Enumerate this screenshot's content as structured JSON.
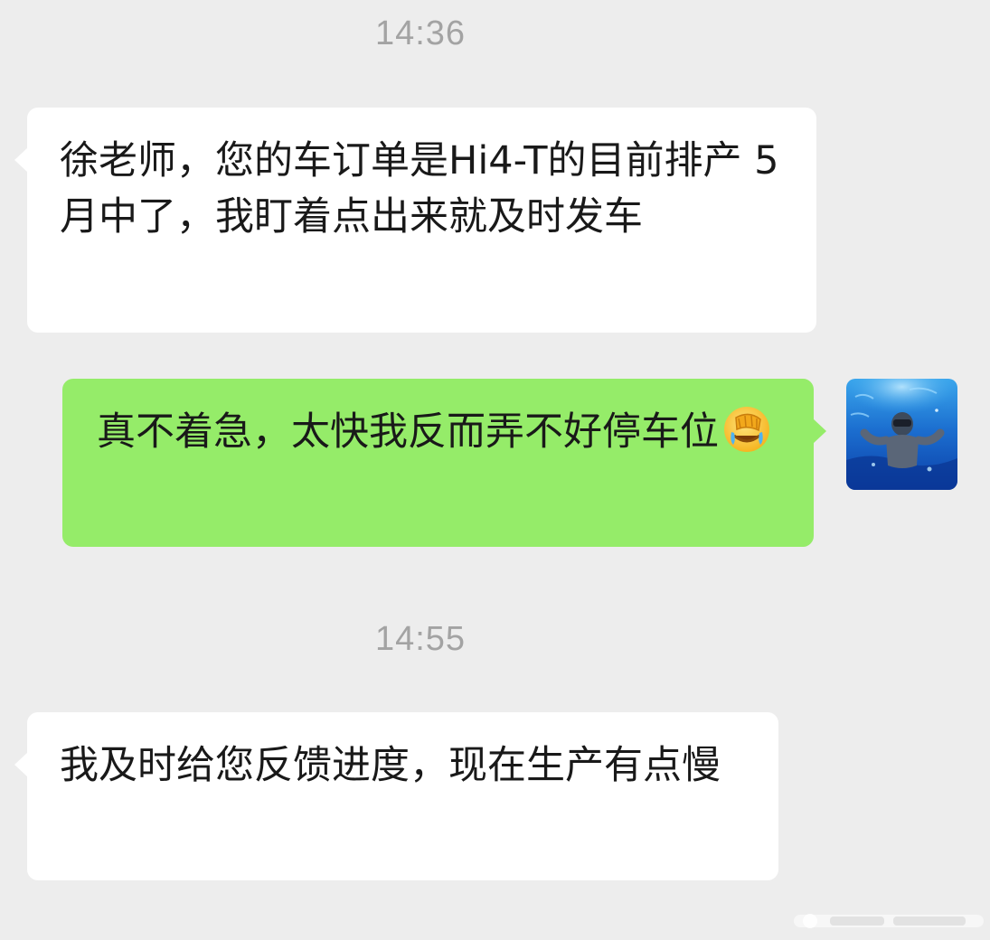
{
  "chat": {
    "timestamps": [
      "14:36",
      "14:55"
    ],
    "messages": [
      {
        "side": "left",
        "text": "徐老师，您的车订单是Hi4-T的目前排产 5月中了，我盯着点出来就及时发车"
      },
      {
        "side": "right",
        "text": "真不着急，太快我反而弄不好停车位",
        "emoji": "facepalm-crying-emoji"
      },
      {
        "side": "left",
        "text": "我及时给您反馈进度，现在生产有点慢"
      }
    ]
  },
  "colors": {
    "background": "#ededed",
    "incoming_bubble": "#ffffff",
    "outgoing_bubble": "#95ec69",
    "timestamp_text": "#a3a3a3",
    "message_text": "#191919"
  },
  "icons": {
    "avatar": "swimmer-underwater-avatar",
    "watermark": "watermark-logo"
  }
}
